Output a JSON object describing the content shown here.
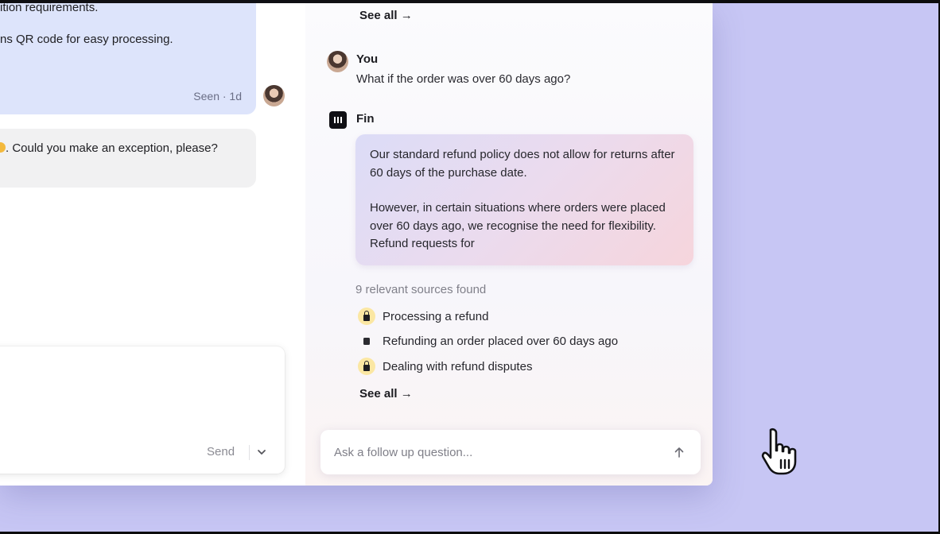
{
  "conversation": {
    "agent_message_line1": "ition requirements.",
    "agent_message_line2": "ns QR code for easy processing.",
    "agent_message_meta": "Seen · 1d",
    "customer_message": ". Could you make an exception, please?",
    "composer": {
      "send_label": "Send"
    }
  },
  "copilot": {
    "see_all_top": "See all →",
    "user_turn": {
      "name": "You",
      "message": "What if the order was over 60 days ago?"
    },
    "fin_turn": {
      "name": "Fin",
      "paragraph1": "Our standard refund policy does not allow for returns after 60 days of the purchase date.",
      "paragraph2": "However, in certain situations where orders were placed over 60 days ago, we recognise the need for flexibility. Refund requests for"
    },
    "sources_title": "9 relevant sources found",
    "sources": [
      {
        "label": "Processing a refund",
        "icon": "lock-icon"
      },
      {
        "label": "Refunding an order placed over 60 days ago",
        "icon": "document-icon"
      },
      {
        "label": "Dealing with refund disputes",
        "icon": "lock-icon"
      }
    ],
    "see_all_bottom": "See all →",
    "followup_placeholder": "Ask a follow up question..."
  },
  "colors": {
    "background": "#c7c6f4",
    "agent_bubble": "#dde4fb",
    "customer_bubble": "#f1f1f2",
    "source_icon_bg": "#fbe7a3"
  }
}
